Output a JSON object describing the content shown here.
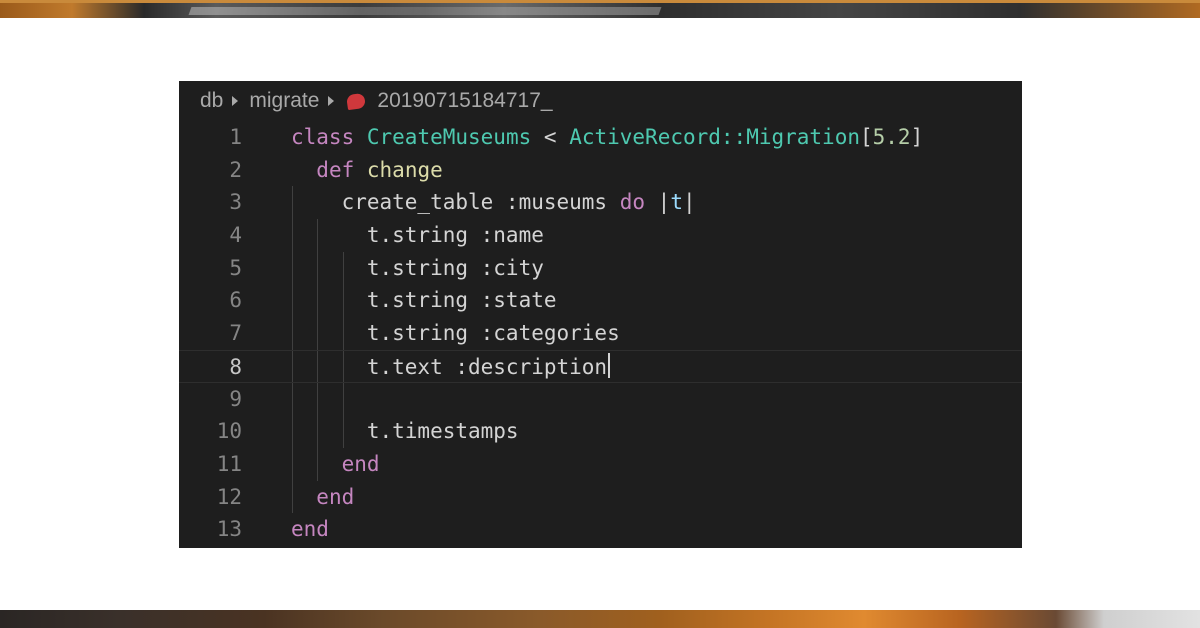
{
  "breadcrumb": {
    "segments": [
      "db",
      "migrate"
    ],
    "file_name": "20190715184717_"
  },
  "colors": {
    "editor_bg": "#1e1e1e",
    "keyword": "#c586c0",
    "class": "#4ec9b0",
    "function": "#dcdcaa",
    "text": "#d4d4d4",
    "number": "#b5cea8",
    "variable": "#9cdcfe",
    "ruby_file_icon": "#d0383c"
  },
  "code": {
    "current_line": 8,
    "lines": [
      {
        "n": "1",
        "tokens": [
          {
            "t": "class",
            "c": "kw"
          },
          {
            "t": " ",
            "c": "pl"
          },
          {
            "t": "CreateMuseums",
            "c": "cls"
          },
          {
            "t": " < ",
            "c": "pl"
          },
          {
            "t": "ActiveRecord::Migration",
            "c": "cls"
          },
          {
            "t": "[",
            "c": "pl"
          },
          {
            "t": "5.2",
            "c": "num"
          },
          {
            "t": "]",
            "c": "pl"
          }
        ]
      },
      {
        "n": "2",
        "tokens": [
          {
            "t": "  ",
            "c": "pl"
          },
          {
            "t": "def",
            "c": "kw"
          },
          {
            "t": " ",
            "c": "pl"
          },
          {
            "t": "change",
            "c": "fn"
          }
        ]
      },
      {
        "n": "3",
        "tokens": [
          {
            "t": "    create_table :museums ",
            "c": "pl"
          },
          {
            "t": "do",
            "c": "kw"
          },
          {
            "t": " |",
            "c": "pl"
          },
          {
            "t": "t",
            "c": "var"
          },
          {
            "t": "|",
            "c": "pl"
          }
        ]
      },
      {
        "n": "4",
        "tokens": [
          {
            "t": "      t.string :name",
            "c": "pl"
          }
        ]
      },
      {
        "n": "5",
        "tokens": [
          {
            "t": "      t.string :city",
            "c": "pl"
          }
        ]
      },
      {
        "n": "6",
        "tokens": [
          {
            "t": "      t.string :state",
            "c": "pl"
          }
        ]
      },
      {
        "n": "7",
        "tokens": [
          {
            "t": "      t.string :categories",
            "c": "pl"
          }
        ]
      },
      {
        "n": "8",
        "tokens": [
          {
            "t": "      t.text :description",
            "c": "pl"
          }
        ]
      },
      {
        "n": "9",
        "tokens": []
      },
      {
        "n": "10",
        "tokens": [
          {
            "t": "      t.timestamps",
            "c": "pl"
          }
        ]
      },
      {
        "n": "11",
        "tokens": [
          {
            "t": "    ",
            "c": "pl"
          },
          {
            "t": "end",
            "c": "kw"
          }
        ]
      },
      {
        "n": "12",
        "tokens": [
          {
            "t": "  ",
            "c": "pl"
          },
          {
            "t": "end",
            "c": "kw"
          }
        ]
      },
      {
        "n": "13",
        "tokens": [
          {
            "t": "end",
            "c": "kw"
          }
        ]
      }
    ]
  }
}
